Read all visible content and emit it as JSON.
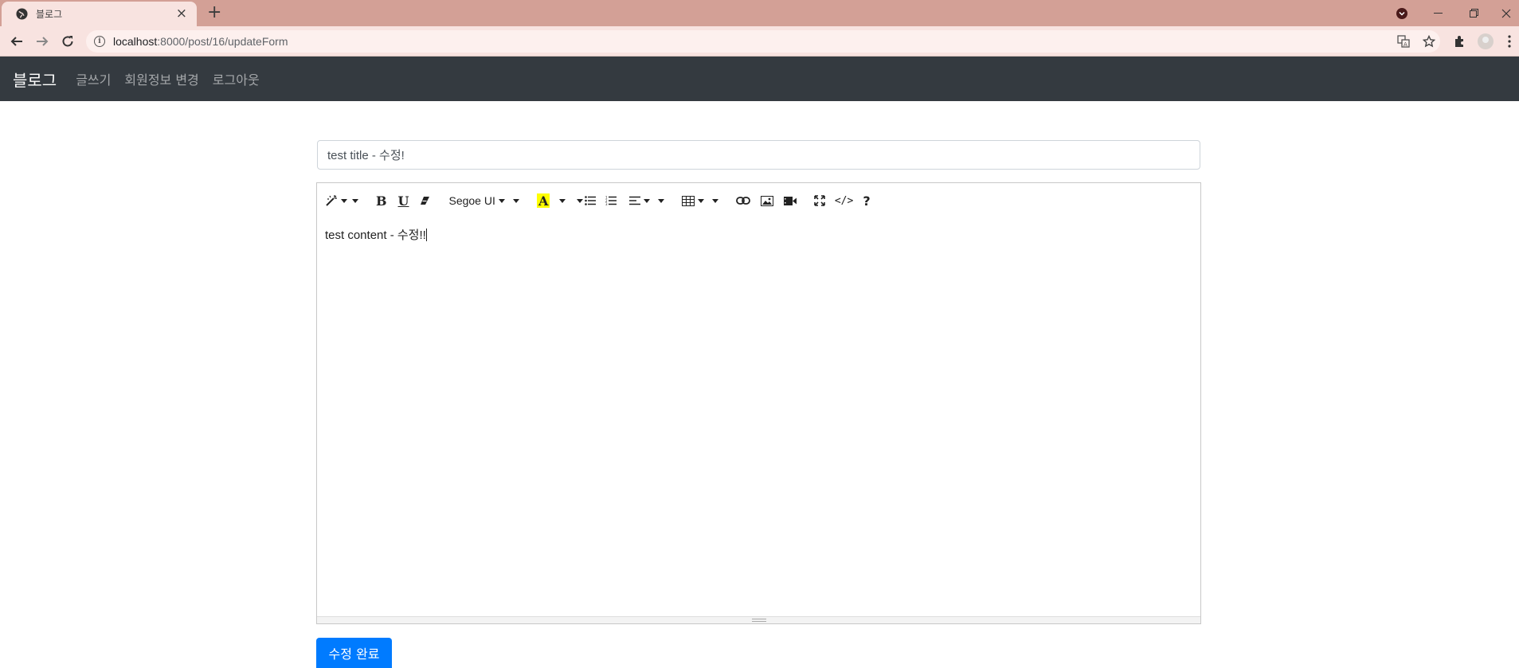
{
  "browser": {
    "tab": {
      "title": "블로그",
      "favicon": "globe-icon",
      "close": "×"
    },
    "new_tab": "+",
    "url": {
      "host": "localhost",
      "rest": ":8000/post/16/updateForm"
    },
    "icons": [
      "back-icon",
      "forward-icon",
      "reload-icon",
      "info-icon",
      "translate-icon",
      "star-icon",
      "extensions-icon",
      "profile-avatar",
      "menu-icon"
    ]
  },
  "navbar": {
    "brand": "블로그",
    "links": [
      {
        "label": "글쓰기"
      },
      {
        "label": "회원정보 변경"
      },
      {
        "label": "로그아웃"
      }
    ]
  },
  "form": {
    "title_value": "test title - 수정!",
    "editor": {
      "font_name": "Segoe UI",
      "content": "test content - 수정!!",
      "toolbar_icons": [
        "style-magic-icon",
        "bold-icon",
        "underline-icon",
        "eraser-icon",
        "font-name-dropdown",
        "text-color-icon",
        "unordered-list-icon",
        "ordered-list-icon",
        "align-icon",
        "table-icon",
        "link-icon",
        "picture-icon",
        "video-icon",
        "fullscreen-icon",
        "codeview-icon",
        "help-icon"
      ],
      "highlight_color": "#ffff00"
    },
    "submit_label": "수정 완료"
  },
  "colors": {
    "navbar_bg": "#343a40",
    "primary": "#007bff",
    "chrome_tab": "#f8e3e0",
    "chrome_strip": "#d3a096"
  }
}
